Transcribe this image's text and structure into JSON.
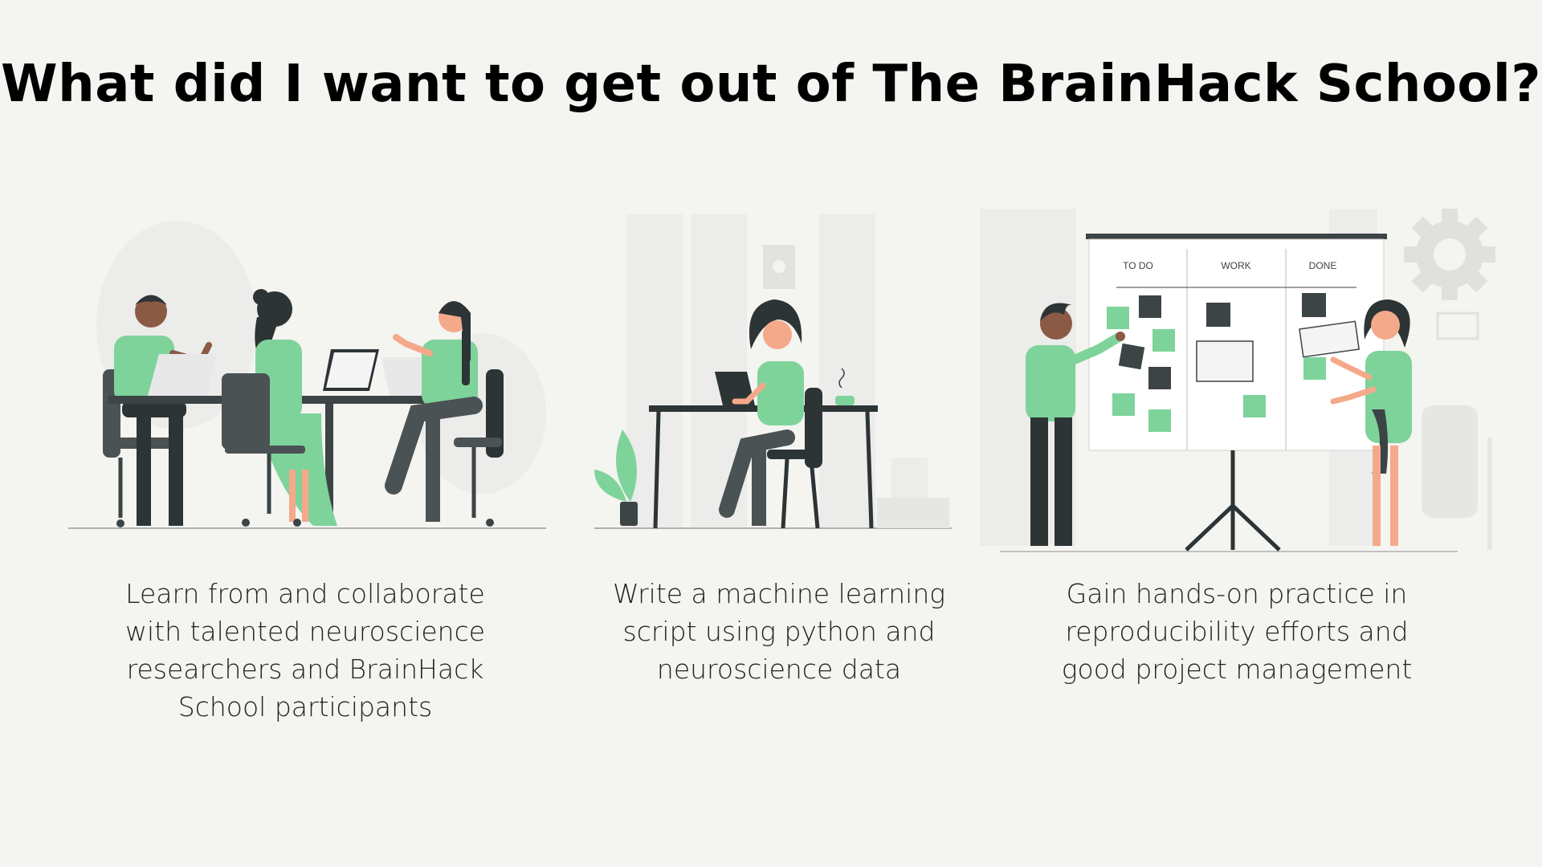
{
  "title": "What did I want to get out of The BrainHack School?",
  "colors": {
    "background": "#f4f4f0",
    "accent_green": "#7ed39b",
    "dark": "#3c4446",
    "skin_dark": "#8a5a44",
    "skin_light": "#f4a98a"
  },
  "panels": [
    {
      "illustration": "team-collaborating-at-table",
      "caption_lines": [
        "Learn from and collaborate",
        "with talented neuroscience",
        "researchers and BrainHack",
        "School participants"
      ]
    },
    {
      "illustration": "woman-working-on-laptop-at-desk",
      "caption_lines": [
        "Write a machine learning",
        "script using python and",
        "neuroscience data"
      ]
    },
    {
      "illustration": "project-management-kanban-board",
      "board_columns": [
        "TO DO",
        "WORK",
        "DONE"
      ],
      "caption_lines": [
        "Gain hands-on practice in",
        "reproducibility efforts and",
        "good project management"
      ]
    }
  ]
}
